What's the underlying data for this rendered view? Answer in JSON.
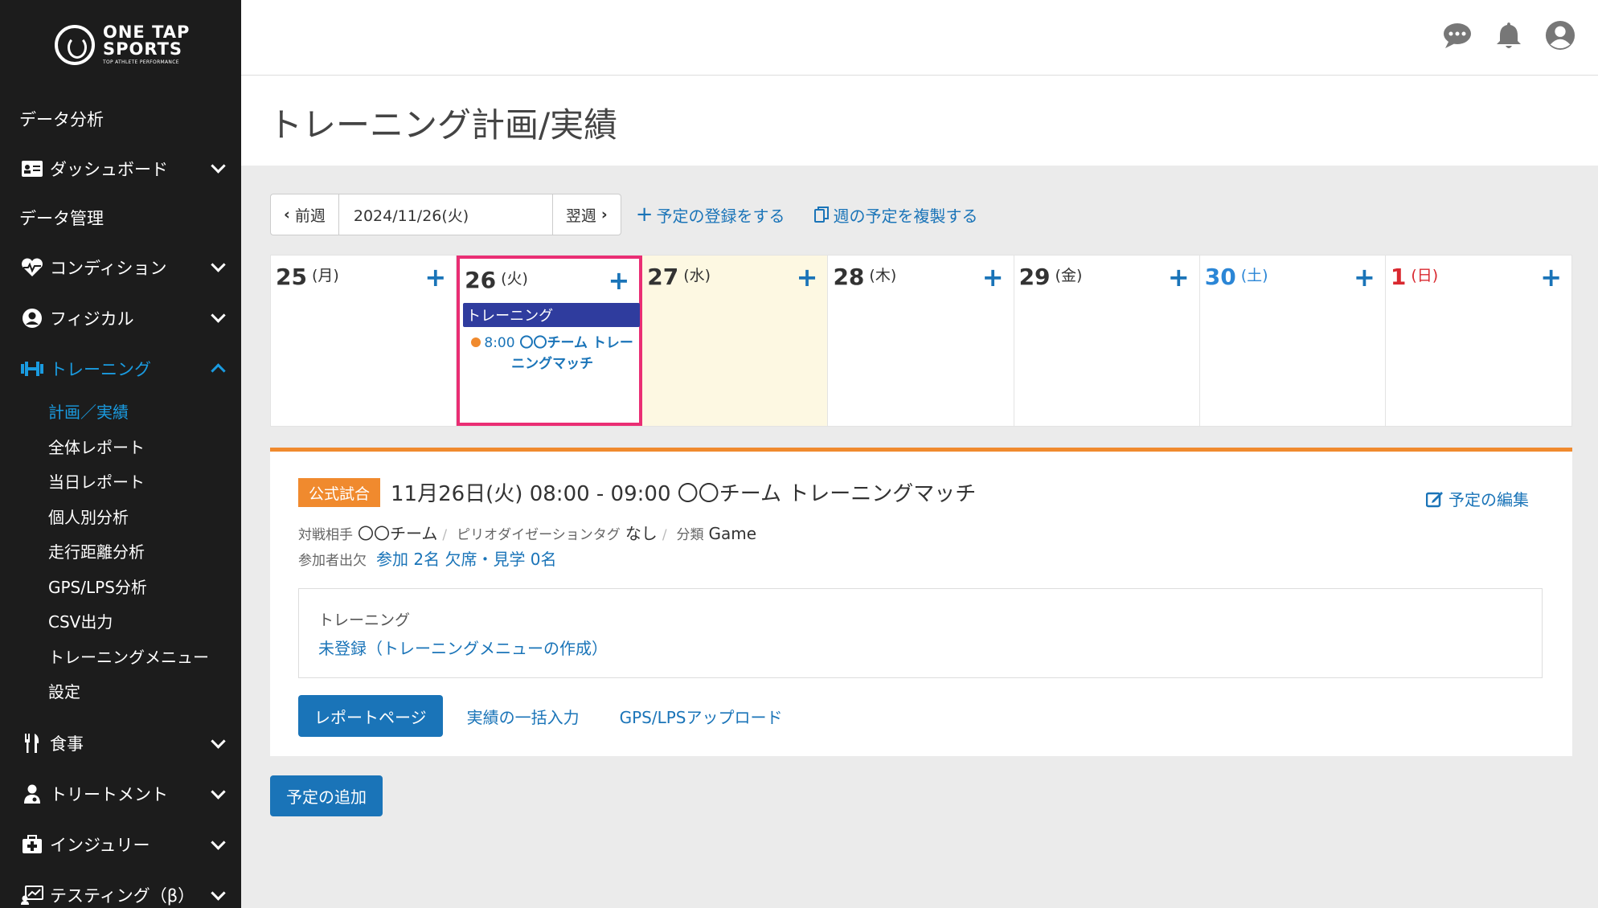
{
  "brand": {
    "line1": "ONE TAP",
    "line2": "SPORTS",
    "tagline": "TOP ATHLETE PERFORMANCE"
  },
  "sidebar": {
    "heading_analysis": "データ分析",
    "dashboard": "ダッシュボード",
    "heading_data": "データ管理",
    "condition": "コンディション",
    "physical": "フィジカル",
    "training": "トレーニング",
    "training_sub": [
      "計画／実績",
      "全体レポート",
      "当日レポート",
      "個人別分析",
      "走行距離分析",
      "GPS/LPS分析",
      "CSV出力",
      "トレーニングメニュー",
      "設定"
    ],
    "meal": "食事",
    "treatment": "トリートメント",
    "injury": "インジュリー",
    "testing": "テスティング（β）"
  },
  "page": {
    "title": "トレーニング計画/実績"
  },
  "week_nav": {
    "prev": "前週",
    "date": "2024/11/26(火)",
    "next": "翌週",
    "register": "予定の登録をする",
    "copy_week": "週の予定を複製する"
  },
  "calendar": {
    "days": [
      {
        "num": "25",
        "dow": "(月)"
      },
      {
        "num": "26",
        "dow": "(火)"
      },
      {
        "num": "27",
        "dow": "(水)"
      },
      {
        "num": "28",
        "dow": "(木)"
      },
      {
        "num": "29",
        "dow": "(金)"
      },
      {
        "num": "30",
        "dow": "(土)"
      },
      {
        "num": "1",
        "dow": "(日)"
      }
    ],
    "add": "+",
    "event_category": "トレーニング",
    "event_time": "8:00",
    "event_name": "〇〇チーム トレーニングマッチ"
  },
  "details": {
    "badge": "公式試合",
    "title": "11月26日(火) 08:00 - 09:00 〇〇チーム トレーニングマッチ",
    "edit": "予定の編集",
    "opponent_label": "対戦相手",
    "opponent": "〇〇チーム",
    "period_label": "ピリオダイゼーションタグ",
    "period": "なし",
    "class_label": "分類",
    "class": "Game",
    "attendance_label": "参加者出欠",
    "attendance": "参加 2名 欠席・見学 0名",
    "training_label": "トレーニング",
    "training_link": "未登録（トレーニングメニューの作成）",
    "report_button": "レポートページ",
    "bulk_input": "実績の一括入力",
    "gps_upload": "GPS/LPSアップロード"
  },
  "add_event": "予定の追加",
  "colors": {
    "accent": "#1a74b8",
    "sidebar_active": "#1a9be0",
    "badge": "#f08a2e",
    "event_bar": "#2f3c9e",
    "selected_border": "#ea2e74"
  }
}
